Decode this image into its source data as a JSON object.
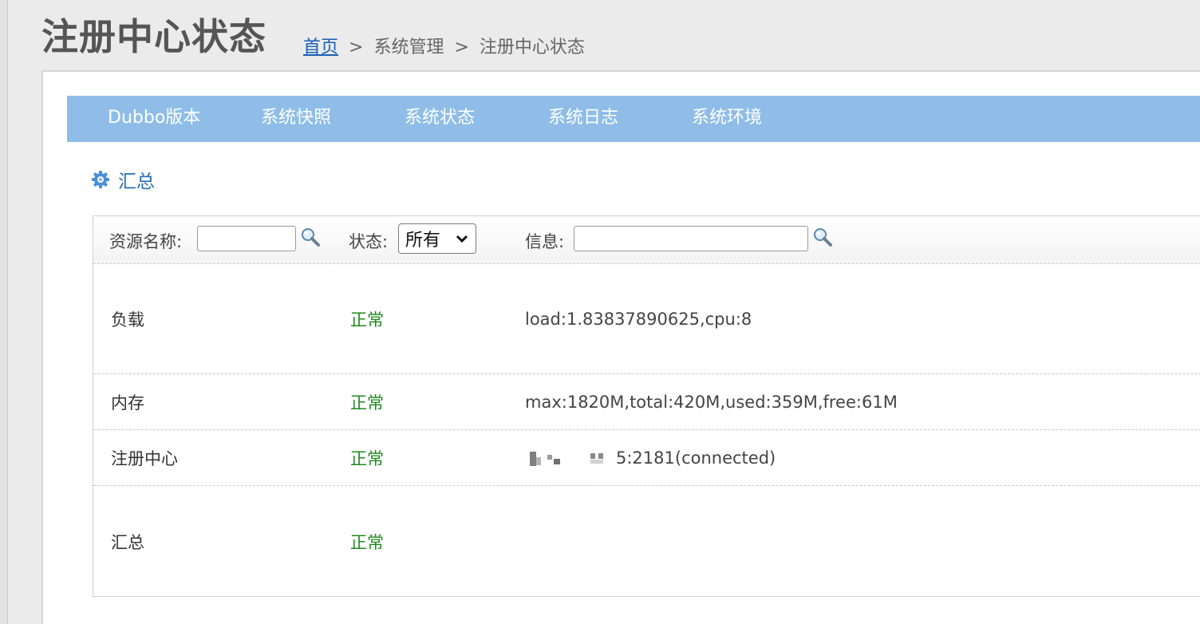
{
  "header": {
    "title": "注册中心状态",
    "breadcrumb": {
      "home": "首页",
      "sep": ">",
      "section": "系统管理",
      "current": "注册中心状态"
    }
  },
  "tabs": [
    {
      "label": "Dubbo版本"
    },
    {
      "label": "系统快照"
    },
    {
      "label": "系统状态"
    },
    {
      "label": "系统日志"
    },
    {
      "label": "系统环境"
    }
  ],
  "section": {
    "title": "汇总",
    "icon": "gear-icon"
  },
  "filter": {
    "resource_label": "资源名称:",
    "resource_value": "",
    "status_label": "状态:",
    "status_selected": "所有",
    "info_label": "信息:",
    "info_value": ""
  },
  "rows": [
    {
      "name": "负载",
      "status": "正常",
      "info": "load:1.83837890625,cpu:8"
    },
    {
      "name": "内存",
      "status": "正常",
      "info": "max:1820M,total:420M,used:359M,free:61M"
    },
    {
      "name": "注册中心",
      "status": "正常",
      "info": "5:2181(connected)"
    },
    {
      "name": "汇总",
      "status": "正常",
      "info": ""
    }
  ],
  "colors": {
    "tabbar": "#8fbde8",
    "status_ok": "#1e8a1e",
    "link": "#1a5fb4"
  }
}
